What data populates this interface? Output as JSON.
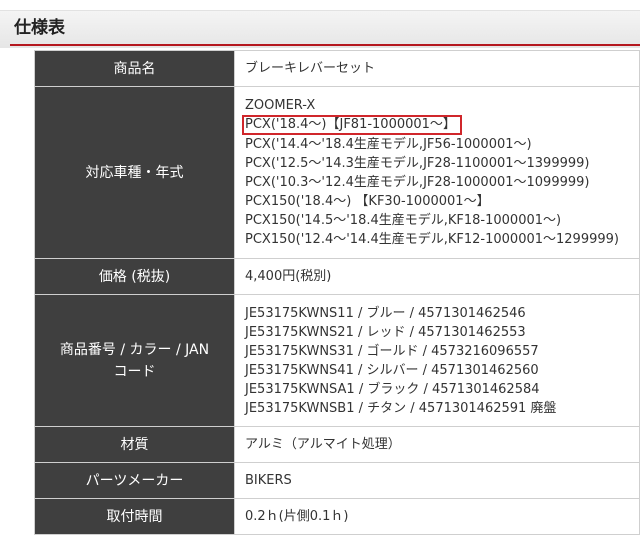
{
  "header": {
    "title": "仕様表"
  },
  "spec": {
    "product_name": {
      "label": "商品名",
      "value": "ブレーキレバーセット"
    },
    "models": {
      "label": "対応車種・年式",
      "lines": [
        "ZOOMER-X",
        "PCX('18.4～)【JF81-1000001～】",
        "PCX('14.4～'18.4生産モデル,JF56-1000001～)",
        "PCX('12.5～'14.3生産モデル,JF28-1100001～1399999)",
        "PCX('10.3～'12.4生産モデル,JF28-1000001～1099999)",
        "PCX150('18.4～) 【KF30-1000001～】",
        "PCX150('14.5～'18.4生産モデル,KF18-1000001～)",
        "PCX150('12.4～'14.4生産モデル,KF12-1000001～1299999)"
      ]
    },
    "price": {
      "label": "価格 (税抜)",
      "value": "4,400円(税別)"
    },
    "sku": {
      "label_line1": "商品番号 / カラー / JAN",
      "label_line2": "コード",
      "lines": [
        "JE53175KWNS11 / ブルー / 4571301462546",
        "JE53175KWNS21 / レッド / 4571301462553",
        "JE53175KWNS31 / ゴールド / 4573216096557",
        "JE53175KWNS41 / シルバー / 4571301462560",
        "JE53175KWNSA1 / ブラック / 4571301462584",
        "JE53175KWNSB1 / チタン / 4571301462591 廃盤"
      ]
    },
    "material": {
      "label": "材質",
      "value": "アルミ（アルマイト処理）"
    },
    "maker": {
      "label": "パーツメーカー",
      "value": "BIKERS"
    },
    "install_time": {
      "label": "取付時間",
      "value": "0.2ｈ(片側0.1ｈ)"
    }
  },
  "colors": {
    "label_cell_bg": "#3f3f3f",
    "header_rule": "#b5181f",
    "highlight_box": "#d0262b"
  }
}
